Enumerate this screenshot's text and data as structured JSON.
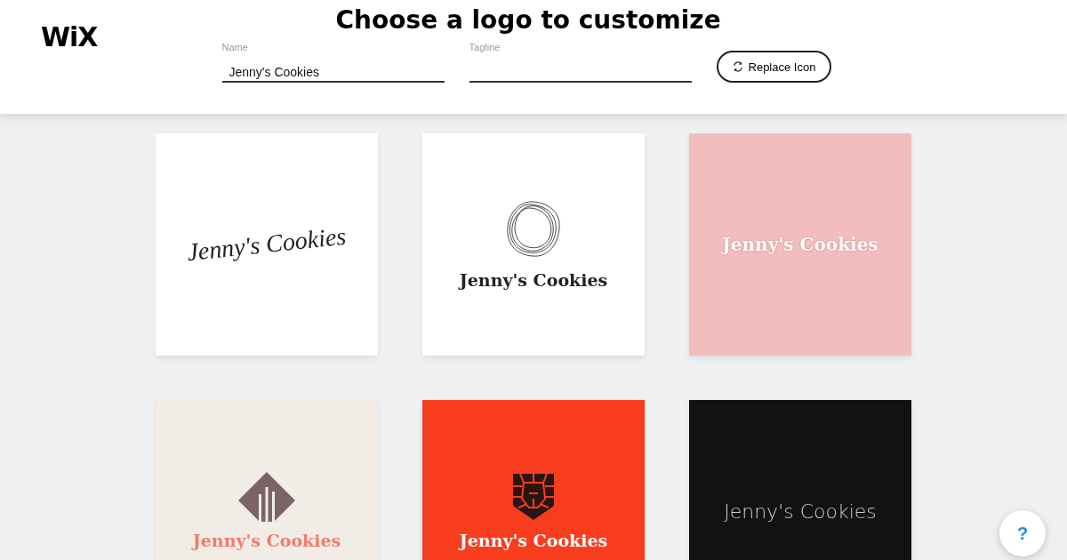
{
  "header": {
    "brand": "WiX",
    "title": "Choose a logo to customize"
  },
  "fields": [
    {
      "label": "Name",
      "value": "Jenny's Cookies"
    },
    {
      "label": "Tagline"
    }
  ],
  "replace_button": {
    "label": "Replace Icon"
  },
  "logos": [
    {
      "kind": "script",
      "name": "Jenny's Cookies"
    },
    {
      "kind": "rings",
      "name": "Jenny's Cookies"
    },
    {
      "kind": "pink",
      "name": "Jenny's Cookies"
    },
    {
      "kind": "diamond",
      "name": "Jenny's Cookies"
    },
    {
      "kind": "shield",
      "name": "Jenny's Cookies"
    },
    {
      "kind": "thin",
      "name": "Jenny's Cookies"
    }
  ],
  "help_button": {
    "label": "?"
  }
}
